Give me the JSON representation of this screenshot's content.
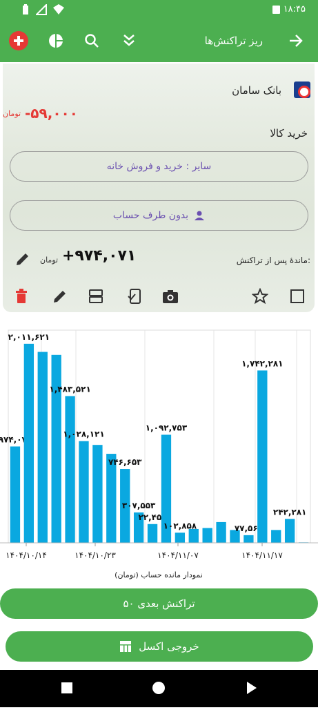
{
  "status": {
    "time": "۱۸:۴۵"
  },
  "appbar": {
    "title": "ریز تراکنش‌ها"
  },
  "transaction": {
    "bank": "بانک سامان",
    "amount": "-۵۹,۰۰۰",
    "unit": "تومان",
    "description": "خرید کالا",
    "category": "سایر : خرید و فروش خانه",
    "party": "بدون طرف حساب",
    "balance_label": "ماندهٔ پس از تراکنش:",
    "balance_value": "+۹۷۴,۰۷۱",
    "balance_unit": "تومان"
  },
  "chart_data": {
    "type": "bar",
    "xlabel": "نمودار مانده حساب (تومان)",
    "x_ticks": [
      "۱۴۰۴/۱۰/۱۴",
      "۱۴۰۴/۱۰/۲۳",
      "۱۴۰۴/۱۱/۰۷",
      "۱۴۰۴/۱۱/۱۷"
    ],
    "ylim": [
      0,
      2150000
    ],
    "values": [
      974071,
      2011621,
      1930000,
      1900000,
      1483521,
      1028121,
      990000,
      900000,
      746653,
      307553,
      190000,
      1092753,
      102858,
      140000,
      150000,
      210000,
      130000,
      77568,
      1742281,
      130000,
      242281,
      5000
    ],
    "labels": [
      "۹۷۴,۰۷۱",
      "۲,۰۱۱,۶۲۱",
      "",
      "",
      "۱,۴۸۳,۵۲۱",
      "۱,۰۲۸,۱۲۱",
      "",
      "",
      "۷۴۶,۶۵۳",
      "۳۰۷,۵۵۳",
      "۲۲,۴۵۳",
      "۱,۰۹۲,۷۵۳",
      "۱۰۲,۸۵۸",
      "",
      "",
      "",
      "",
      "۷۷,۵۶۸",
      "۱,۷۴۲,۲۸۱",
      "",
      "۲۴۲,۲۸۱",
      ""
    ],
    "color": "#0aa8e0",
    "grid": true
  },
  "buttons": {
    "next": "۵۰ تراکنش بعدی",
    "excel": "خروجی اکسل"
  },
  "colors": {
    "accent": "#4caf50",
    "negative": "#e53935",
    "bar": "#0aa8e0"
  }
}
